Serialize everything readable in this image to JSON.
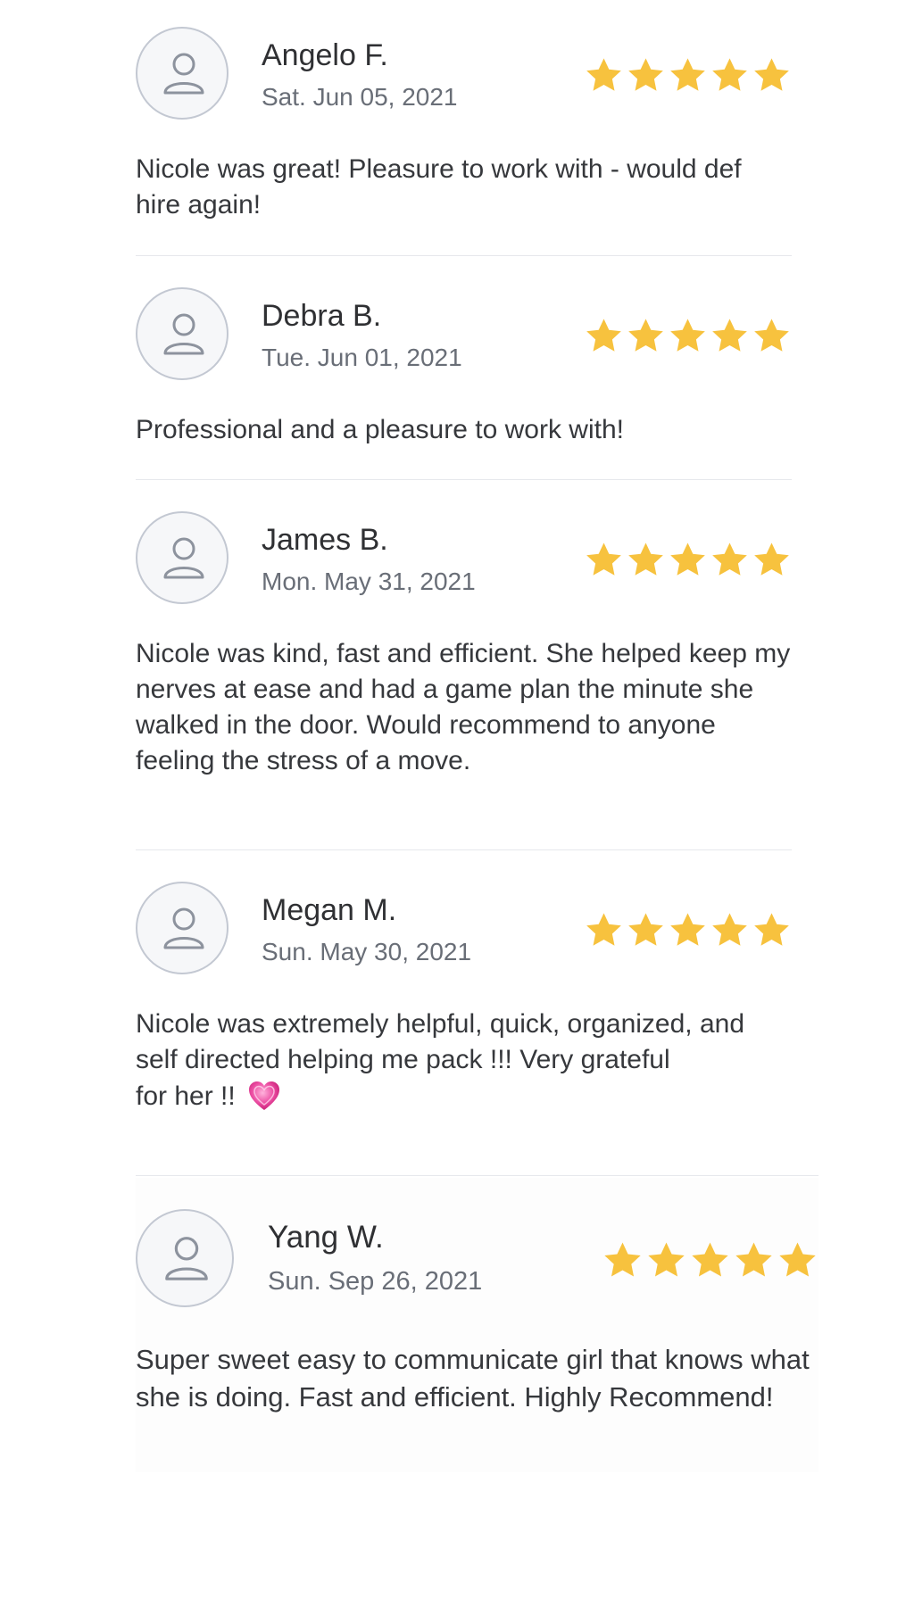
{
  "reviews": [
    {
      "name": "Angelo F.",
      "date": "Sat. Jun 05, 2021",
      "rating": 5,
      "text": "Nicole was great! Pleasure to work with - would def hire again!"
    },
    {
      "name": "Debra B.",
      "date": "Tue. Jun 01, 2021",
      "rating": 5,
      "text": "Professional and a pleasure to work with!"
    },
    {
      "name": "James B.",
      "date": "Mon. May 31, 2021",
      "rating": 5,
      "text": "Nicole was kind, fast and efficient. She helped keep my nerves at ease and had a game plan the minute she walked in the door. Would recommend to anyone feeling the stress of a move."
    },
    {
      "name": "Megan M.",
      "date": "Sun. May 30, 2021",
      "rating": 5,
      "text_line1": "Nicole was extremely helpful, quick, organized, and self directed helping me pack !!! Very grateful",
      "text_line2": "for her !!",
      "emoji": "sparkling-heart-icon"
    },
    {
      "name": "Yang W.",
      "date": "Sun. Sep 26, 2021",
      "rating": 5,
      "text": "Super sweet easy to communicate girl that knows what she is doing. Fast and efficient. Highly Recommend!"
    }
  ],
  "colors": {
    "star": "#f7c23e",
    "divider": "#e6e8ec",
    "avatar_border": "#c3c8d2",
    "name": "#2f3033",
    "date": "#696e77"
  }
}
